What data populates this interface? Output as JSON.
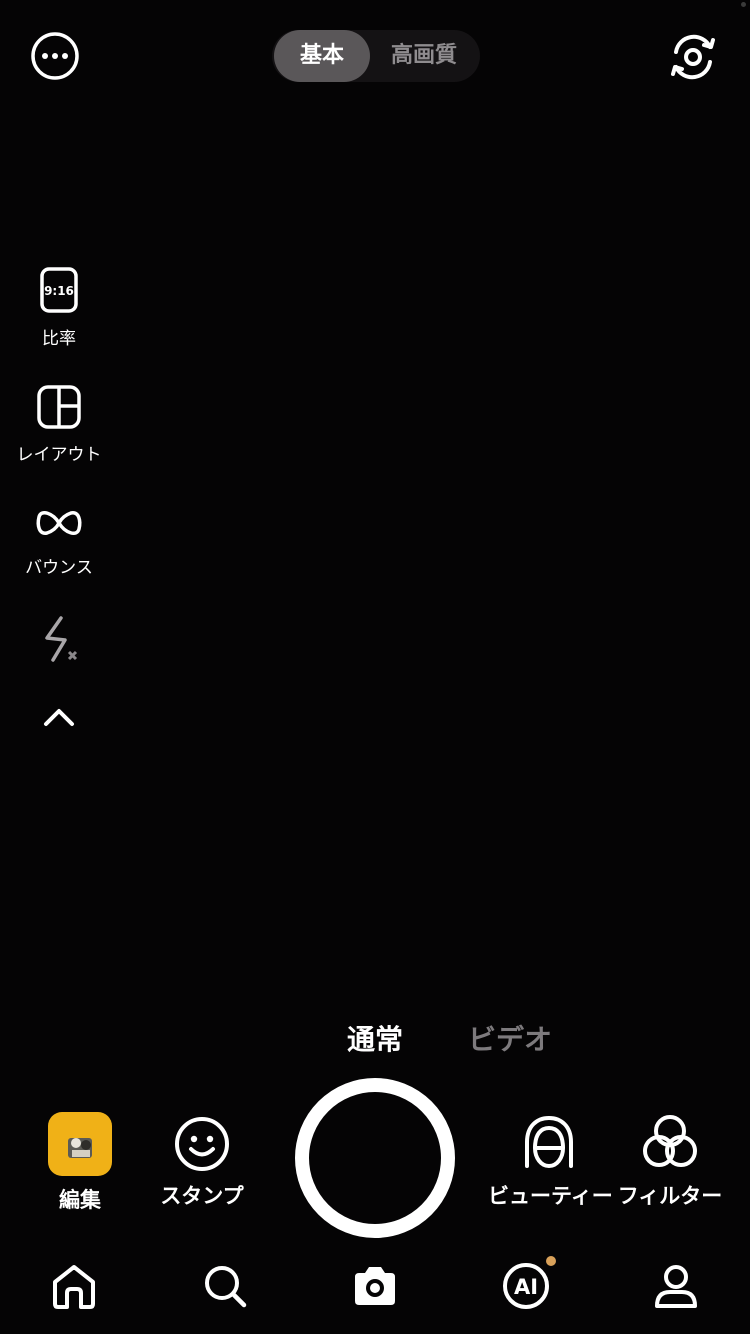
{
  "top_bar": {
    "more_icon": "more-dots-icon",
    "quality": {
      "options": [
        "基本",
        "高画質"
      ],
      "selected": "基本"
    },
    "flip_icon": "camera-flip-icon"
  },
  "left_rail": {
    "ratio": {
      "badge": "9:16",
      "label": "比率",
      "icon": "aspect-ratio-icon"
    },
    "layout": {
      "label": "レイアウト",
      "icon": "layout-grid-icon"
    },
    "bounce": {
      "label": "バウンス",
      "icon": "bounce-infinity-icon"
    },
    "flash": {
      "icon": "flash-off-icon",
      "state": "off"
    },
    "collapse": {
      "icon": "chevron-up-icon"
    }
  },
  "modes": {
    "items": [
      "通常",
      "ビデオ"
    ],
    "selected": "通常"
  },
  "actions": {
    "edit": {
      "label": "編集",
      "icon": "gallery-thumbnail"
    },
    "stamp": {
      "label": "スタンプ",
      "icon": "smiley-icon"
    },
    "shutter": {
      "icon": "shutter-button"
    },
    "beauty": {
      "label": "ビューティー",
      "icon": "beauty-face-icon"
    },
    "filter": {
      "label": "フィルター",
      "icon": "filter-circles-icon"
    }
  },
  "bottom_nav": {
    "items": [
      {
        "icon": "home-icon"
      },
      {
        "icon": "search-icon"
      },
      {
        "icon": "camera-icon",
        "active": true
      },
      {
        "icon": "ai-icon",
        "text": "AI",
        "has_badge": true
      },
      {
        "icon": "profile-icon"
      }
    ]
  },
  "colors": {
    "background": "#050405",
    "accent_thumb": "#f0b117",
    "badge_dot": "#d9a15a",
    "inactive_text": "#7d7a7d"
  }
}
